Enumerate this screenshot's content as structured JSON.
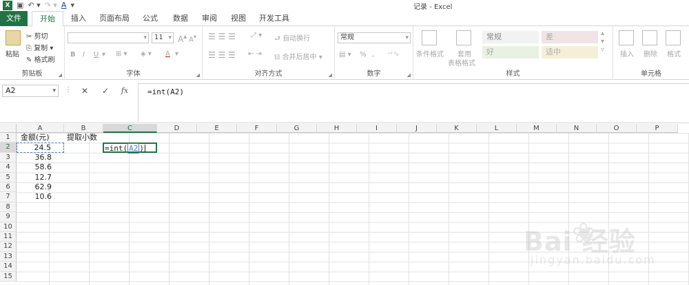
{
  "window": {
    "title": "记录 - Excel",
    "app_icon": "X"
  },
  "qat": {
    "save_icon": "save-icon",
    "undo_icon": "undo-icon",
    "redo_icon": "redo-icon",
    "font_color_icon": "A"
  },
  "tabs": [
    {
      "label": "文件"
    },
    {
      "label": "开始"
    },
    {
      "label": "插入"
    },
    {
      "label": "页面布局"
    },
    {
      "label": "公式"
    },
    {
      "label": "数据"
    },
    {
      "label": "审阅"
    },
    {
      "label": "视图"
    },
    {
      "label": "开发工具"
    }
  ],
  "ribbon": {
    "clipboard": {
      "paste": "粘贴",
      "cut": "剪切",
      "copy": "复制",
      "format_painter": "格式刷",
      "group": "剪贴板"
    },
    "font": {
      "size": "11",
      "bold": "B",
      "italic": "I",
      "underline": "U",
      "grow": "A",
      "shrink": "A",
      "color": "A",
      "group": "字体"
    },
    "alignment": {
      "wrap": "自动换行",
      "merge": "合并后居中",
      "group": "对齐方式"
    },
    "number": {
      "format": "常规",
      "percent": "%",
      "comma": ",",
      "group": "数字"
    },
    "styles": {
      "conditional": "条件格式",
      "table": "套用",
      "table2": "表格格式",
      "normal": "常规",
      "bad": "差",
      "good": "好",
      "neutral": "适中",
      "group": "样式"
    },
    "cells": {
      "insert": "插入",
      "delete": "删除",
      "format": "格式",
      "group": "单元格"
    }
  },
  "formula_bar": {
    "name_box": "A2",
    "cancel": "✕",
    "enter": "✓",
    "fx": "fx",
    "formula": "=int(A2)"
  },
  "grid": {
    "columns": [
      "A",
      "B",
      "C",
      "D",
      "E",
      "F",
      "G",
      "H",
      "I",
      "J",
      "K",
      "L",
      "M",
      "N",
      "O",
      "P"
    ],
    "rows": [
      "1",
      "2",
      "3",
      "4",
      "5",
      "6",
      "7",
      "8",
      "9",
      "10",
      "11",
      "12",
      "13",
      "14",
      "15"
    ],
    "cells": {
      "A1": "金额(元)",
      "B1": "提取小数",
      "A2": "24.5",
      "A3": "36.8",
      "A4": "58.6",
      "A5": "12.7",
      "A6": "62.9",
      "A7": "10.6",
      "C2_prefix": "=int(",
      "C2_ref": "A2",
      "C2_suffix": ")"
    }
  },
  "watermark": {
    "main": "Bai  经验",
    "sub": "jingyan.baidu.com"
  }
}
